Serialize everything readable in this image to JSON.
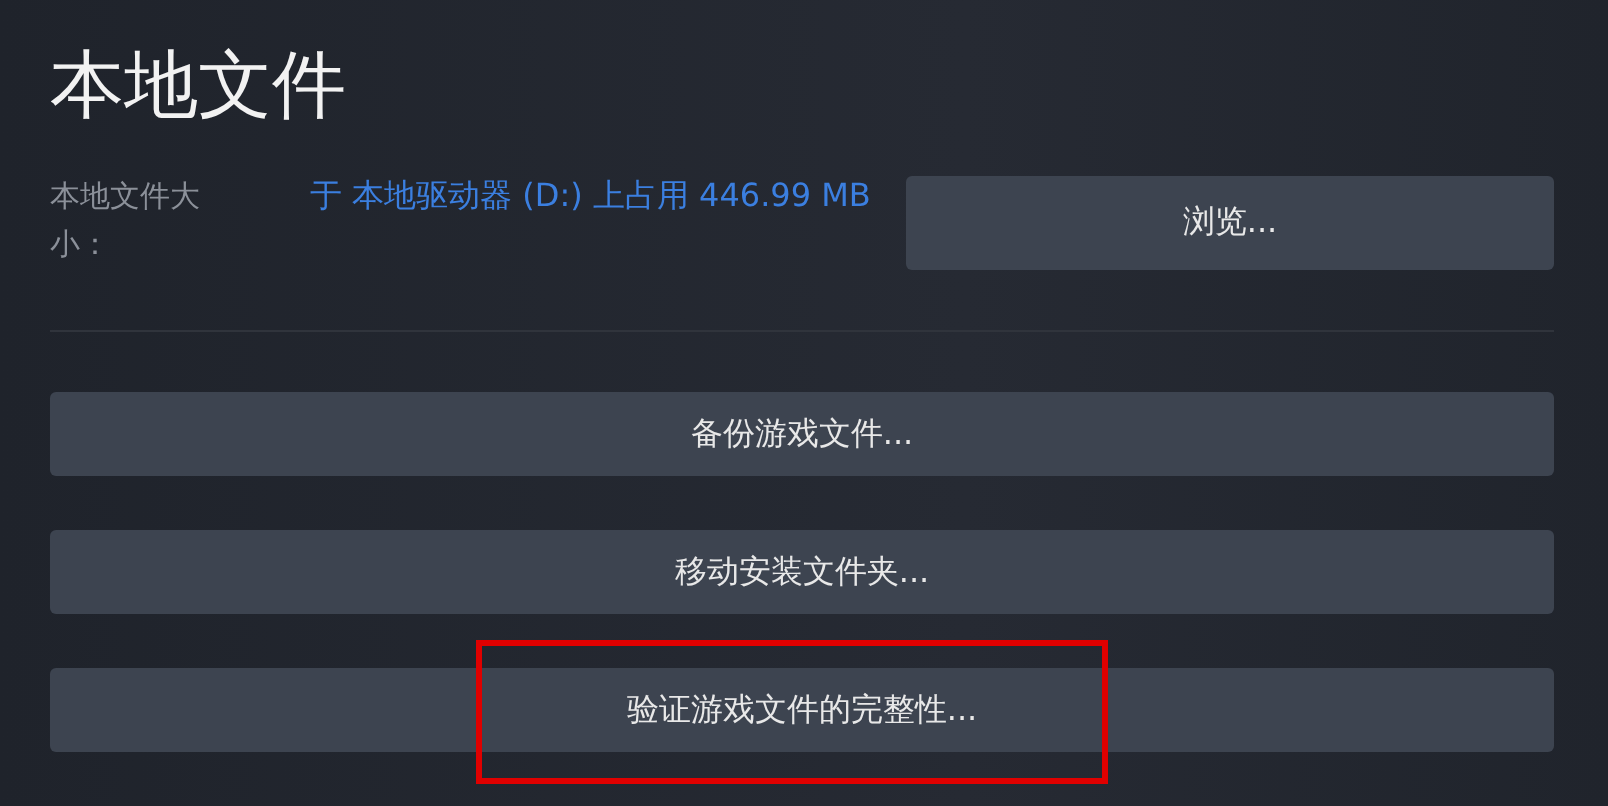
{
  "title": "本地文件",
  "size_label": "本地文件大小：",
  "size_value": "于 本地驱动器 (D:) 上占用 446.99 MB",
  "browse_button": "浏览...",
  "actions": [
    {
      "label": "备份游戏文件...",
      "highlighted": false
    },
    {
      "label": "移动安装文件夹...",
      "highlighted": false
    },
    {
      "label": "验证游戏文件的完整性...",
      "highlighted": true
    }
  ]
}
